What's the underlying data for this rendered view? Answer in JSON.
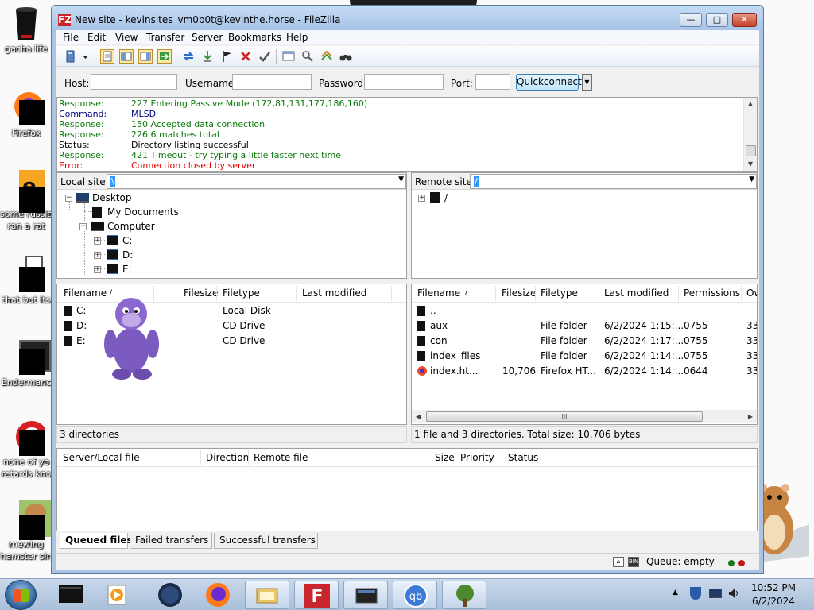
{
  "desktop": {
    "icons": [
      {
        "label": "gacha life"
      },
      {
        "label": "Firefox"
      },
      {
        "label": "some russian"
      },
      {
        "label": "ran a rat"
      },
      {
        "label": "that but its"
      },
      {
        "label": "Endermanc"
      },
      {
        "label": "none of yo"
      },
      {
        "label": "retards kno"
      },
      {
        "label": "mewing"
      },
      {
        "label": "hamster sin"
      }
    ]
  },
  "window": {
    "title": "New site - kevinsites_vm0b0t@kevinthe.horse - FileZilla",
    "app_icon": "FZ",
    "controls": {
      "minimize": "—",
      "maximize": "□",
      "close": "✕"
    }
  },
  "menu": [
    "File",
    "Edit",
    "View",
    "Transfer",
    "Server",
    "Bookmarks",
    "Help"
  ],
  "toolbar_icons": [
    "site-manager-icon",
    "dropdown-icon",
    "toggle-log-icon",
    "toggle-local-tree-icon",
    "toggle-remote-tree-icon",
    "toggle-queue-icon",
    "refresh-icon",
    "process-queue-icon",
    "cancel-icon",
    "disconnect-icon",
    "reconnect-icon",
    "filter-icon",
    "compare-icon",
    "sync-browse-icon",
    "search-icon"
  ],
  "quickconnect": {
    "host_label": "Host:",
    "host_value": "",
    "username_label": "Username:",
    "password_label": "Password:",
    "port_label": "Port:",
    "button": "Quickconnect",
    "dropdown": "▼"
  },
  "log": [
    {
      "key": "Response:",
      "text": "227 Entering Passive Mode (172,81,131,177,186,160)",
      "color": "#0a7a0a"
    },
    {
      "key": "Command:",
      "text": "MLSD",
      "color": "#000080"
    },
    {
      "key": "Response:",
      "text": "150 Accepted data connection",
      "color": "#0a7a0a"
    },
    {
      "key": "Response:",
      "text": "226 6 matches total",
      "color": "#0a7a0a"
    },
    {
      "key": "Status:",
      "text": "Directory listing successful",
      "color": "#000000"
    },
    {
      "key": "Response:",
      "text": "421 Timeout - try typing a little faster next time",
      "color": "#0a7a0a"
    },
    {
      "key": "Error:",
      "text": "Connection closed by server",
      "color": "#e00000"
    }
  ],
  "local": {
    "site_label": "Local site:",
    "site_value": "\\",
    "tree": {
      "desktop": "Desktop",
      "documents": "My Documents",
      "computer": "Computer",
      "c": "C:",
      "d": "D:",
      "e": "E:"
    },
    "columns": [
      "Filename",
      "/",
      "Filesize",
      "Filetype",
      "Last modified"
    ],
    "files": [
      {
        "name": "C:",
        "type": "Local Disk"
      },
      {
        "name": "D:",
        "type": "CD Drive"
      },
      {
        "name": "E:",
        "type": "CD Drive"
      }
    ],
    "status": "3 directories"
  },
  "remote": {
    "site_label": "Remote site:",
    "site_value": "/",
    "tree_root": "/",
    "columns": [
      "Filename",
      "/",
      "Filesize",
      "Filetype",
      "Last modified",
      "Permissions",
      "Ow"
    ],
    "files": [
      {
        "name": "..",
        "size": "",
        "type": "",
        "modified": "",
        "perm": "",
        "owner": ""
      },
      {
        "name": "aux",
        "size": "",
        "type": "File folder",
        "modified": "6/2/2024 1:15:...",
        "perm": "0755",
        "owner": "33"
      },
      {
        "name": "con",
        "size": "",
        "type": "File folder",
        "modified": "6/2/2024 1:17:...",
        "perm": "0755",
        "owner": "33"
      },
      {
        "name": "index_files",
        "size": "",
        "type": "File folder",
        "modified": "6/2/2024 1:14:...",
        "perm": "0755",
        "owner": "33"
      },
      {
        "name": "index.ht...",
        "size": "10,706",
        "type": "Firefox HT...",
        "modified": "6/2/2024 1:14:...",
        "perm": "0644",
        "owner": "33"
      }
    ],
    "hscroll_grip": "III",
    "status": "1 file and 3 directories. Total size: 10,706 bytes"
  },
  "queue": {
    "columns": [
      "Server/Local file",
      "Direction",
      "Remote file",
      "Size",
      "Priority",
      "Status"
    ],
    "tabs": [
      "Queued files",
      "Failed transfers",
      "Successful transfers"
    ],
    "active_tab": 0
  },
  "statusbar": {
    "queue_text": "Queue: empty",
    "led_colors": [
      "#1a7a1a",
      "#c01818"
    ]
  },
  "taskbar": {
    "time": "10:52 PM",
    "date": "6/2/2024",
    "items": [
      "start-button",
      "app-1",
      "media-player",
      "browser-globe",
      "firefox",
      "file-explorer",
      "filezilla",
      "app-monitor",
      "qbittorrent",
      "tree-app"
    ]
  },
  "colors": {
    "accent": "#3399ff",
    "filezilla_red": "#c8262c"
  }
}
